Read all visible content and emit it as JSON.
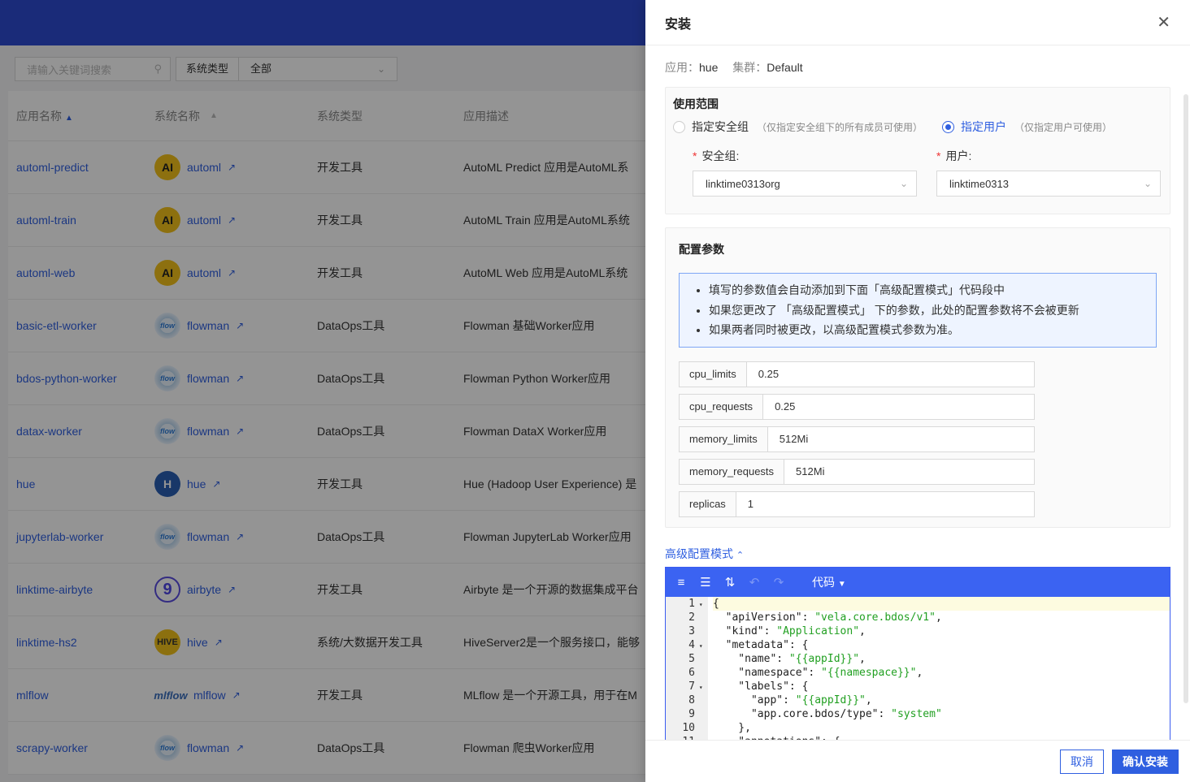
{
  "background": {
    "search_placeholder": "请输入关键词搜索",
    "filter_label": "系统类型",
    "filter_value": "全部",
    "columns": [
      "应用名称",
      "系统名称",
      "系统类型",
      "应用描述"
    ],
    "rows": [
      {
        "name": "automl-predict",
        "system": "automl",
        "logo": "AI",
        "type": "开发工具",
        "desc": "AutoML Predict 应用是AutoML系"
      },
      {
        "name": "automl-train",
        "system": "automl",
        "logo": "AI",
        "type": "开发工具",
        "desc": "AutoML Train 应用是AutoML系统"
      },
      {
        "name": "automl-web",
        "system": "automl",
        "logo": "AI",
        "type": "开发工具",
        "desc": "AutoML Web 应用是AutoML系统"
      },
      {
        "name": "basic-etl-worker",
        "system": "flowman",
        "logo": "flow",
        "type": "DataOps工具",
        "desc": "Flowman 基础Worker应用"
      },
      {
        "name": "bdos-python-worker",
        "system": "flowman",
        "logo": "flow",
        "type": "DataOps工具",
        "desc": "Flowman Python Worker应用"
      },
      {
        "name": "datax-worker",
        "system": "flowman",
        "logo": "flow",
        "type": "DataOps工具",
        "desc": "Flowman DataX Worker应用"
      },
      {
        "name": "hue",
        "system": "hue",
        "logo": "H",
        "type": "开发工具",
        "desc": "Hue (Hadoop User Experience) 是"
      },
      {
        "name": "jupyterlab-worker",
        "system": "flowman",
        "logo": "flow",
        "type": "DataOps工具",
        "desc": "Flowman JupyterLab Worker应用"
      },
      {
        "name": "linktime-airbyte",
        "system": "airbyte",
        "logo": "9",
        "type": "开发工具",
        "desc": "Airbyte 是一个开源的数据集成平台"
      },
      {
        "name": "linktime-hs2",
        "system": "hive",
        "logo": "HIVE",
        "type": "系统/大数据开发工具",
        "desc": "HiveServer2是一个服务接口，能够"
      },
      {
        "name": "mlflow",
        "system": "mlflow",
        "logo": "mlflow",
        "type": "开发工具",
        "desc": "MLflow 是一个开源工具，用于在M"
      },
      {
        "name": "scrapy-worker",
        "system": "flowman",
        "logo": "flow",
        "type": "DataOps工具",
        "desc": "Flowman 爬虫Worker应用"
      }
    ]
  },
  "drawer": {
    "title": "安装",
    "app_key": "应用：",
    "app_value": "hue",
    "cluster_key": "集群：",
    "cluster_value": "Default",
    "scope_title": "使用范围",
    "radio_group": "指定安全组",
    "radio_group_hint": "（仅指定安全组下的所有成员可使用）",
    "radio_user": "指定用户",
    "radio_user_hint": "（仅指定用户可使用）",
    "secgroup_label": "安全组:",
    "secgroup_value": "linktime0313org",
    "user_label": "用户:",
    "user_value": "linktime0313",
    "params_title": "配置参数",
    "tips": [
      "填写的参数值会自动添加到下面「高级配置模式」代码段中",
      "如果您更改了 「高级配置模式」 下的参数，此处的配置参数将不会被更新",
      "如果两者同时被更改，以高级配置模式参数为准。"
    ],
    "params": [
      {
        "key": "cpu_limits",
        "value": "0.25"
      },
      {
        "key": "cpu_requests",
        "value": "0.25"
      },
      {
        "key": "memory_limits",
        "value": "512Mi"
      },
      {
        "key": "memory_requests",
        "value": "512Mi"
      },
      {
        "key": "replicas",
        "value": "1"
      }
    ],
    "advanced_label": "高级配置模式",
    "editor_mode": "代码",
    "code_lines": [
      {
        "n": "1",
        "fold": true,
        "text": "{"
      },
      {
        "n": "2",
        "fold": false,
        "text": "  \"apiVersion\": \"vela.core.bdos/v1\","
      },
      {
        "n": "3",
        "fold": false,
        "text": "  \"kind\": \"Application\","
      },
      {
        "n": "4",
        "fold": true,
        "text": "  \"metadata\": {"
      },
      {
        "n": "5",
        "fold": false,
        "text": "    \"name\": \"{{appId}}\","
      },
      {
        "n": "6",
        "fold": false,
        "text": "    \"namespace\": \"{{namespace}}\","
      },
      {
        "n": "7",
        "fold": true,
        "text": "    \"labels\": {"
      },
      {
        "n": "8",
        "fold": false,
        "text": "      \"app\": \"{{appId}}\","
      },
      {
        "n": "9",
        "fold": false,
        "text": "      \"app.core.bdos/type\": \"system\""
      },
      {
        "n": "10",
        "fold": false,
        "text": "    },"
      },
      {
        "n": "11",
        "fold": true,
        "text": "    \"annotations\": {"
      }
    ],
    "cancel_label": "取消",
    "confirm_label": "确认安装"
  }
}
